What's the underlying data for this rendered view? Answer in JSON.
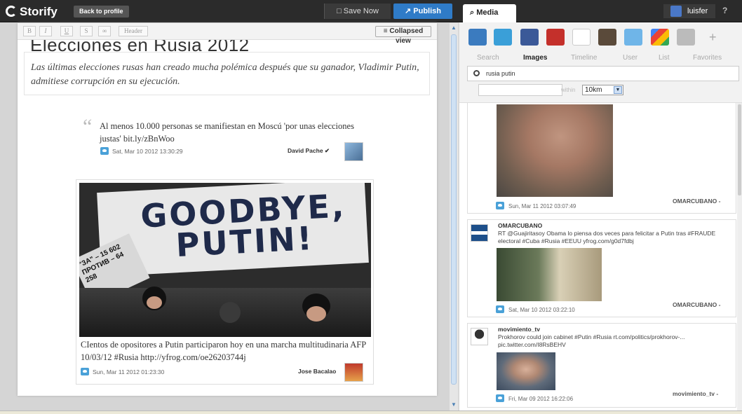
{
  "topbar": {
    "logo": "Storify",
    "back": "Back to profile",
    "save": "Save Now",
    "publish": "Publish",
    "media_tab": "Media",
    "user": "luisfer",
    "help": "?"
  },
  "toolbar": {
    "bold": "B",
    "italic": "I",
    "underline": "U",
    "strike": "S",
    "link": "♀",
    "header": "Header",
    "collapsed": "Collapsed view"
  },
  "story": {
    "title": "Elecciones en Rusia 2012",
    "description": "Las últimas elecciones rusas han creado mucha polémica después que su ganador, Vladimir Putin, admitiese corrupción en su ejecución.",
    "quote_mark": "“",
    "tweet": {
      "text": "Al menos 10.000 personas se manifiestan en Moscú 'por unas elecciones justas' bit.ly/zBnWoo",
      "date": "Sat, Mar 10 2012 13:30:29",
      "author": "David Pache ✔"
    },
    "image_card": {
      "sign_text": "GOODBYE, PUTIN!",
      "small_sign": "\"ЗА\" – 15 602 ПРОТИВ – 64 258",
      "caption": "CIentos de opositores a Putin participaron hoy en una marcha multitudinaria AFP 10/03/12 #Rusia http://yfrog.com/oe26203744j",
      "date": "Sun, Mar 11 2012 01:23:30",
      "author": "Jose Bacalao"
    }
  },
  "media": {
    "tabs": [
      "Search",
      "Images",
      "Timeline",
      "User",
      "List",
      "Favorites"
    ],
    "active_tab": "Images",
    "search_value": "rusia putin",
    "within_label": "within",
    "radius": "10km",
    "plus": "+",
    "results": [
      {
        "date": "Sun, Mar 11 2012 03:07:49",
        "by": "OMARCUBANO -"
      },
      {
        "handle": "OMARCUBANO",
        "text": "RT @Guajiritasoy Obama lo piensa dos veces para felicitar a Putin tras #FRAUDE electoral #Cuba #Rusia #EEUU yfrog.com/g0d7fdbj",
        "date": "Sat, Mar 10 2012 03:22:10",
        "by": "OMARCUBANO -"
      },
      {
        "handle": "movimiento_tv",
        "text": "Prokhorov could join cabinet #Putin #Rusia rt.com/politics/prokhorov-... pic.twitter.com/I8RsBEHV",
        "date": "Fri, Mar 09 2012 16:22:06",
        "by": "movimiento_tv -"
      }
    ]
  },
  "colors": {
    "publish": "#2f7bc7",
    "twitter": "#4aa1d8",
    "topbar": "#2b2b2b"
  }
}
